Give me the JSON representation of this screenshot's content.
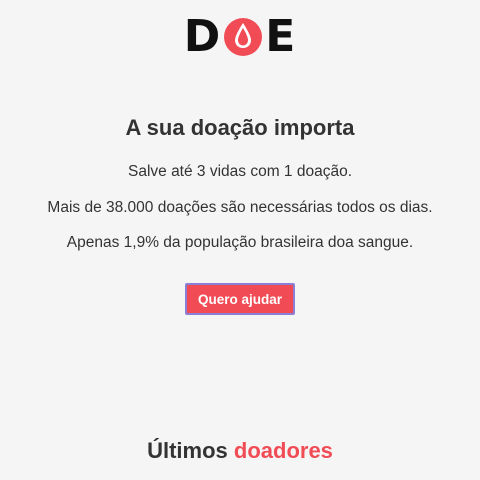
{
  "brand": {
    "logo_left": "D",
    "logo_right": "E",
    "drop_icon": "blood-drop-icon",
    "accent_color": "#f14c56"
  },
  "hero": {
    "title": "A sua doação importa",
    "lines": [
      "Salve até 3 vidas com 1 doação.",
      "Mais de 38.000 doações são necessárias todos os dias.",
      "Apenas 1,9% da população brasileira doa sangue."
    ],
    "cta_label": "Quero ajudar"
  },
  "donors": {
    "heading_prefix": "Últimos",
    "heading_accent": "doadores"
  }
}
